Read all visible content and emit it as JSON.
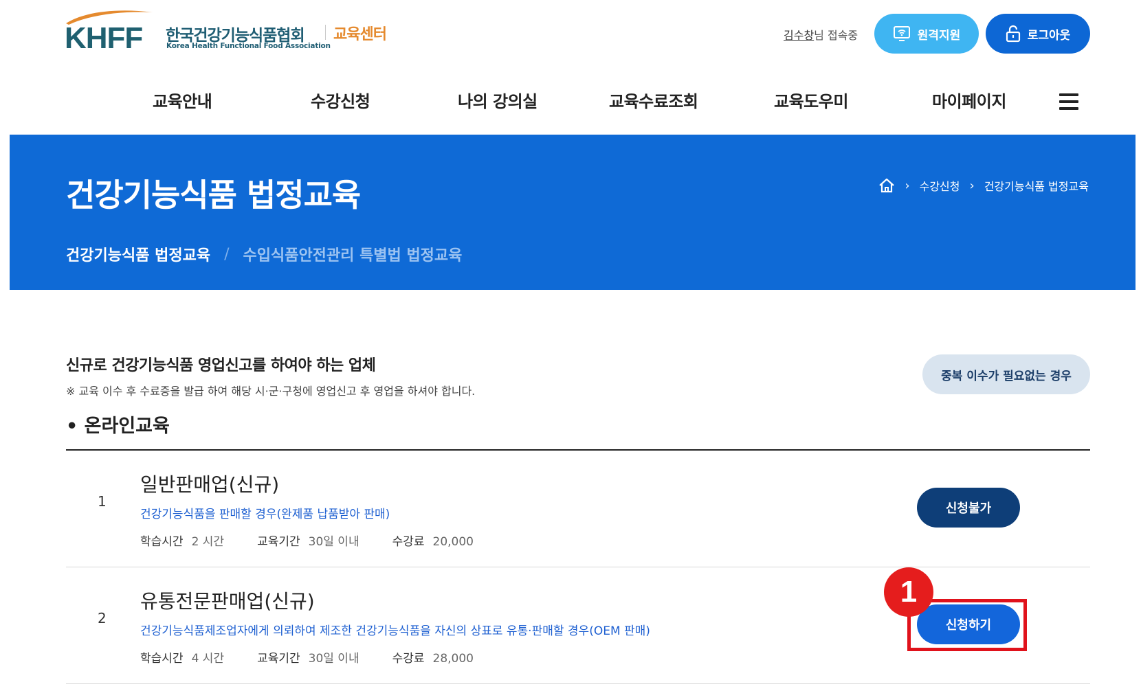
{
  "header": {
    "logo_mark": "KHFF",
    "logo_korean": "한국건강기능식품협회",
    "logo_english": "Korea Health Functional Food Association",
    "logo_center": "교육센터",
    "user_name": "김수창",
    "user_suffix": "님 접속중",
    "remote_label": "원격지원",
    "logout_label": "로그아웃"
  },
  "nav": {
    "items": [
      "교육안내",
      "수강신청",
      "나의 강의실",
      "교육수료조회",
      "교육도우미",
      "마이페이지"
    ]
  },
  "banner": {
    "title": "건강기능식품 법정교육",
    "breadcrumb": [
      "수강신청",
      "건강기능식품 법정교육"
    ],
    "tabs": {
      "active": "건강기능식품 법정교육",
      "separator": "/",
      "inactive": "수입식품안전관리 특별법 법정교육"
    }
  },
  "section": {
    "title": "신규로 건강기능식품 영업신고를 하여야 하는 업체",
    "note": "※ 교육 이수 후 수료증을 발급 하여 해당 시·군·구청에 영업신고 후 영업을 하셔야 합니다.",
    "dup_button": "중복 이수가 필요없는 경우",
    "online_title": "• 온라인교육"
  },
  "courses": [
    {
      "num": "1",
      "title": "일반판매업(신규)",
      "desc": "건강기능식품을 판매할 경우(완제품 납품받아 판매)",
      "hours_label": "학습시간",
      "hours": "2 시간",
      "period_label": "교육기간",
      "period": "30일 이내",
      "fee_label": "수강료",
      "fee": "20,000",
      "button": "신청불가"
    },
    {
      "num": "2",
      "title": "유통전문판매업(신규)",
      "desc": "건강기능식품제조업자에게 의뢰하여 제조한 건강기능식품을 자신의 상표로 유통·판매할 경우(OEM 판매)",
      "hours_label": "학습시간",
      "hours": "4 시간",
      "period_label": "교육기간",
      "period": "30일 이내",
      "fee_label": "수강료",
      "fee": "28,000",
      "button": "신청하기"
    }
  ],
  "annotation": {
    "badge": "1"
  },
  "colors": {
    "banner": "#0f6ad6",
    "remote_button": "#3fb5f2",
    "logout_button": "#0d67d5",
    "disabled_button": "#0e3e78",
    "apply_button": "#1366db",
    "annotation_red": "#e0121b",
    "logo_orange": "#e58a2e",
    "logo_teal": "#1f6070"
  }
}
